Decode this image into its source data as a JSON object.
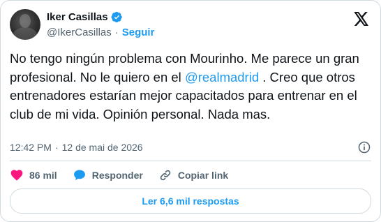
{
  "author": {
    "display_name": "Iker Casillas",
    "handle": "@IkerCasillas",
    "separator": "·",
    "follow_label": "Seguir",
    "verified": true
  },
  "tweet": {
    "text_part1": "No tengo ningún problema con Mourinho. Me parece un gran profesional. No le quiero en el ",
    "mention": "@realmadrid",
    "text_part2": " . Creo que otros entrenadores estarían mejor capacitados para entrenar en el club de mi vida. Opinión personal. Nada mas.",
    "time": "12:42 PM",
    "date_separator": "·",
    "date": "12 de mai de 2026"
  },
  "actions": {
    "likes_count": "86 mil",
    "reply_label": "Responder",
    "copy_link_label": "Copiar link"
  },
  "replies_button_label": "Ler 6,6 mil respostas",
  "colors": {
    "accent": "#1d9bf0",
    "like": "#f91880",
    "text": "#0f1419",
    "secondary": "#536471",
    "border": "#cfd9de"
  }
}
